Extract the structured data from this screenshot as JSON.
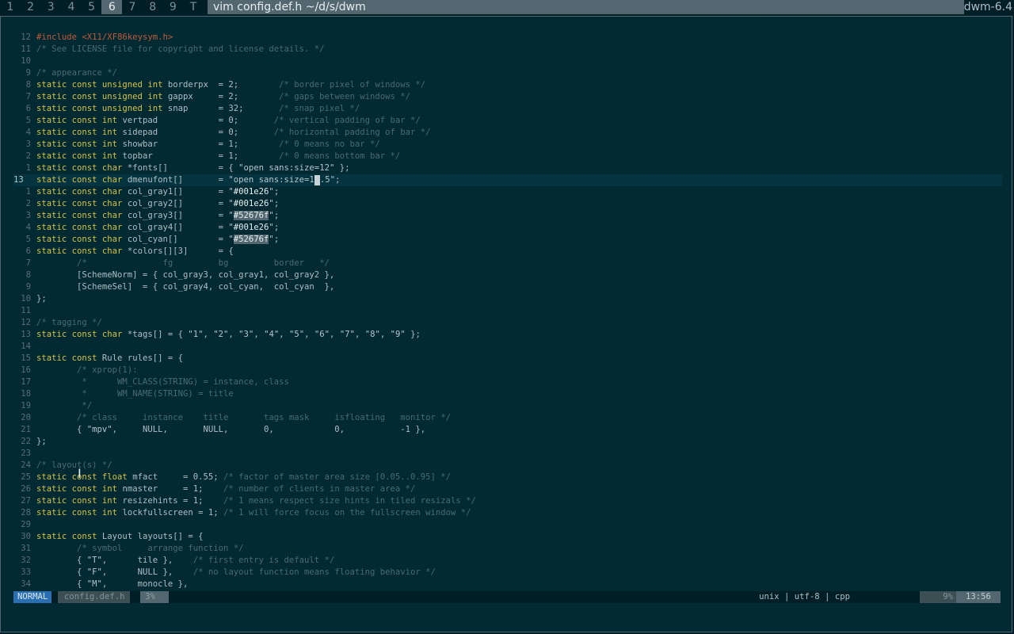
{
  "bar": {
    "tags": [
      "1",
      "2",
      "3",
      "4",
      "5",
      "6",
      "7",
      "8",
      "9",
      "T"
    ],
    "selected_tag": "6",
    "window_title": "vim config.def.h ~/d/s/dwm",
    "status_text": "dwm-6.4"
  },
  "editor": {
    "cursor_line": "13",
    "lines": [
      {
        "nr": "12",
        "html": "<span class='pp'>#include</span> <span class='pp'>&lt;X11/XF86keysym.h&gt;</span>"
      },
      {
        "nr": "11",
        "html": "<span class='cm'>/* See LICENSE file for copyright and license details. */</span>"
      },
      {
        "nr": "10",
        "html": ""
      },
      {
        "nr": "9",
        "html": "<span class='cm'>/* appearance */</span>"
      },
      {
        "nr": "8",
        "html": "<span class='kw'>static const unsigned int</span> borderpx  = 2;        <span class='cm'>/* border pixel of windows */</span>"
      },
      {
        "nr": "7",
        "html": "<span class='kw'>static const unsigned int</span> gappx     = 2;        <span class='cm'>/* gaps between windows */</span>"
      },
      {
        "nr": "6",
        "html": "<span class='kw'>static const unsigned int</span> snap      = 32;       <span class='cm'>/* snap pixel */</span>"
      },
      {
        "nr": "5",
        "html": "<span class='kw'>static const int</span> vertpad            = 0;       <span class='cm'>/* vertical padding of bar */</span>"
      },
      {
        "nr": "4",
        "html": "<span class='kw'>static const int</span> sidepad            = 0;       <span class='cm'>/* horizontal padding of bar */</span>"
      },
      {
        "nr": "3",
        "html": "<span class='kw'>static const int</span> showbar            = 1;        <span class='cm'>/* 0 means no bar */</span>"
      },
      {
        "nr": "2",
        "html": "<span class='kw'>static const int</span> topbar             = 1;        <span class='cm'>/* 0 means bottom bar */</span>"
      },
      {
        "nr": "1",
        "html": "<span class='kw'>static const char</span> *fonts[]          = { <span class='st'>\"open sans:size=12\"</span> };"
      },
      {
        "nr": "13",
        "cur": true,
        "html": "<span class='kw'>static const char</span> dmenufont[]       = <span class='st'>\"open sans:size=1<span class='cursor'></span>.5\"</span>;"
      },
      {
        "nr": "1",
        "html": "<span class='kw'>static const char</span> col_gray1[]       = <span class='st'>\"<span class='wh'>#001e26</span>\"</span>;"
      },
      {
        "nr": "2",
        "html": "<span class='kw'>static const char</span> col_gray2[]       = <span class='st'>\"<span class='wh'>#001e26</span>\"</span>;"
      },
      {
        "nr": "3",
        "html": "<span class='kw'>static const char</span> col_gray3[]       = <span class='st'>\"<span class='hl'>#52676f</span>\"</span>;"
      },
      {
        "nr": "4",
        "html": "<span class='kw'>static const char</span> col_gray4[]       = <span class='st'>\"<span class='wh'>#001e26</span>\"</span>;"
      },
      {
        "nr": "5",
        "html": "<span class='kw'>static const char</span> col_cyan[]        = <span class='st'>\"<span class='hl'>#52676f</span>\"</span>;"
      },
      {
        "nr": "6",
        "html": "<span class='kw'>static const char</span> *colors[][3]      = {"
      },
      {
        "nr": "7",
        "html": "        <span class='cm'>/*               fg         bg         border   */</span>"
      },
      {
        "nr": "8",
        "html": "        [SchemeNorm] = { col_gray3, col_gray1, col_gray2 },"
      },
      {
        "nr": "9",
        "html": "        [SchemeSel]  = { col_gray4, col_cyan,  col_cyan  },"
      },
      {
        "nr": "10",
        "html": "};"
      },
      {
        "nr": "11",
        "html": ""
      },
      {
        "nr": "12",
        "html": "<span class='cm'>/* tagging */</span>"
      },
      {
        "nr": "13",
        "html": "<span class='kw'>static const char</span> *tags[] = { <span class='st'>\"1\"</span>, <span class='st'>\"2\"</span>, <span class='st'>\"3\"</span>, <span class='st'>\"4\"</span>, <span class='st'>\"5\"</span>, <span class='st'>\"6\"</span>, <span class='st'>\"7\"</span>, <span class='st'>\"8\"</span>, <span class='st'>\"9\"</span> };"
      },
      {
        "nr": "14",
        "html": ""
      },
      {
        "nr": "15",
        "html": "<span class='kw'>static const</span> Rule rules[] = {"
      },
      {
        "nr": "16",
        "html": "        <span class='cm'>/* xprop(1):</span>"
      },
      {
        "nr": "17",
        "html": "<span class='cm'>         *      WM_CLASS(STRING) = instance, class</span>"
      },
      {
        "nr": "18",
        "html": "<span class='cm'>         *      WM_NAME(STRING) = title</span>"
      },
      {
        "nr": "19",
        "html": "<span class='cm'>         */</span>"
      },
      {
        "nr": "20",
        "html": "        <span class='cm'>/* class     instance    title       tags mask     isfloating   monitor */</span>"
      },
      {
        "nr": "21",
        "html": "        { <span class='st'>\"mpv\"</span>,     NULL,       NULL,       0,            0,           -1 },"
      },
      {
        "nr": "22",
        "html": "};"
      },
      {
        "nr": "23",
        "html": ""
      },
      {
        "nr": "24",
        "html": "<span class='cm'>/* layout(s) */</span>"
      },
      {
        "nr": "25",
        "html": "<span class='kw'>static const float</span> mfact     = 0.55; <span class='cm'>/* factor of master area size [0.05..0.95] */</span>"
      },
      {
        "nr": "26",
        "html": "<span class='kw'>static const int</span> nmaster     = 1;    <span class='cm'>/* number of clients in master area */</span>"
      },
      {
        "nr": "27",
        "html": "<span class='kw'>static const int</span> resizehints = 1;    <span class='cm'>/* 1 means respect size hints in tiled resizals */</span>"
      },
      {
        "nr": "28",
        "html": "<span class='kw'>static const int</span> lockfullscreen = 1; <span class='cm'>/* 1 will force focus on the fullscreen window */</span>"
      },
      {
        "nr": "29",
        "html": ""
      },
      {
        "nr": "30",
        "html": "<span class='kw'>static const</span> Layout layouts[] = {"
      },
      {
        "nr": "31",
        "html": "        <span class='cm'>/* symbol     arrange function */</span>"
      },
      {
        "nr": "32",
        "html": "        { <span class='st'>\"T\"</span>,      tile },    <span class='cm'>/* first entry is default */</span>"
      },
      {
        "nr": "33",
        "html": "        { <span class='st'>\"F\"</span>,      NULL },    <span class='cm'>/* no layout function means floating behavior */</span>"
      },
      {
        "nr": "34",
        "html": "        { <span class='st'>\"M\"</span>,      monocle },"
      }
    ]
  },
  "statusline": {
    "mode": "NORMAL",
    "filename": "config.def.h",
    "percent_left": "3%",
    "fileformat": "unix",
    "encoding": "utf-8",
    "filetype": "cpp",
    "separator": "|",
    "percent_right": "9%",
    "position": "13:56"
  }
}
